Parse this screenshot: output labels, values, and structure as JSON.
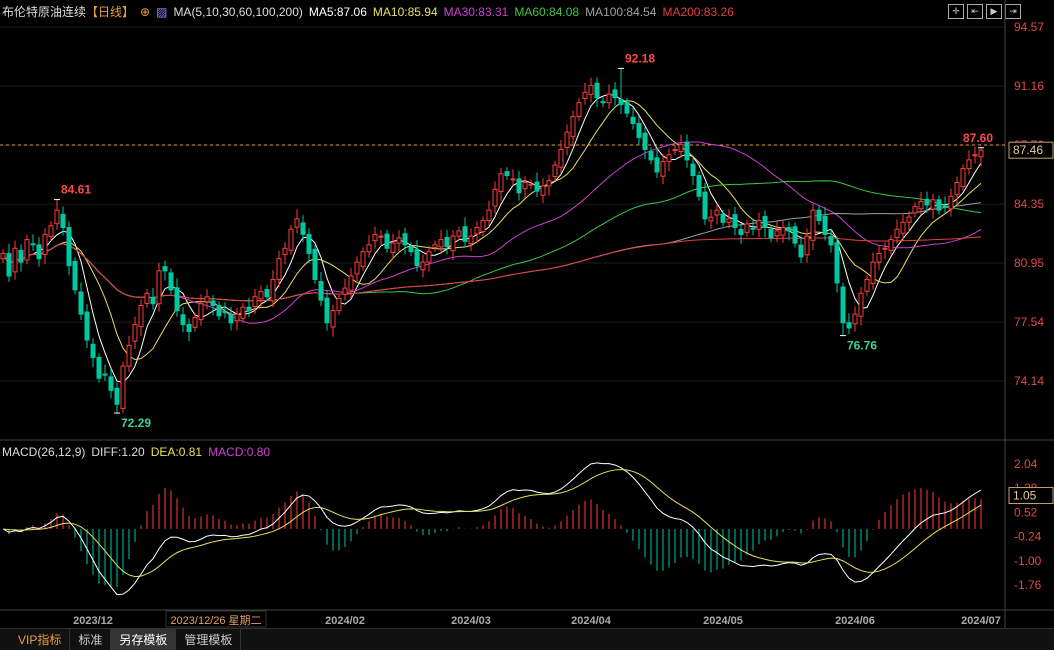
{
  "header": {
    "title": "布伦特原油连续",
    "period": "【日线】",
    "ma_label": "MA(5,10,30,60,100,200)",
    "ma5": "MA5:87.06",
    "ma10": "MA10:85.94",
    "ma30": "MA30:83.31",
    "ma60": "MA60:84.08",
    "ma100": "MA100:84.54",
    "ma200": "MA200:83.26"
  },
  "macd_header": {
    "label": "MACD(26,12,9)",
    "diff": "DIFF:1.20",
    "dea": "DEA:0.81",
    "macd": "MACD:0.80"
  },
  "toolbar_icons": [
    "crosshair-icon",
    "zoom-range-icon",
    "play-icon",
    "exit-icon"
  ],
  "bottom_tabs": [
    "VIP指标",
    "标准",
    "另存模板",
    "管理模板"
  ],
  "colors": {
    "up": "#ff3c3c",
    "down": "#00c8a0",
    "ma5": "#ffffff",
    "ma10": "#e8e060",
    "ma30": "#d040d0",
    "ma60": "#3cc83c",
    "ma100": "#a0a0a0",
    "ma200": "#e04040"
  },
  "chart_data": {
    "type": "candlestick",
    "price_axis": {
      "ticks": [
        "94.57",
        "91.16",
        "87.76",
        "84.35",
        "80.95",
        "77.54",
        "74.14"
      ],
      "range": [
        74.14,
        94.57
      ],
      "current": "87.46",
      "dashed_level": 87.76
    },
    "macd_axis": {
      "ticks": [
        "2.04",
        "1.28",
        "0.52",
        "-0.24",
        "-1.00",
        "-1.76"
      ],
      "range": [
        -1.76,
        2.04
      ],
      "current": "1.05"
    },
    "closes": [
      81.5,
      80.2,
      81.8,
      81.0,
      82.3,
      82.0,
      81.2,
      82.6,
      83.1,
      84.0,
      83.0,
      80.8,
      79.4,
      78.0,
      76.5,
      75.5,
      74.3,
      74.5,
      73.6,
      72.8,
      75.0,
      76.2,
      77.4,
      78.5,
      79.2,
      78.6,
      80.5,
      80.5,
      79.4,
      78.2,
      77.4,
      77.0,
      77.8,
      78.6,
      79.0,
      78.5,
      77.9,
      78.1,
      77.5,
      78.0,
      78.4,
      78.2,
      79.0,
      79.3,
      79.0,
      80.0,
      81.2,
      81.8,
      82.9,
      83.5,
      82.6,
      81.5,
      80.0,
      78.8,
      77.5,
      78.2,
      78.9,
      79.5,
      80.2,
      81.0,
      81.6,
      82.0,
      82.6,
      82.5,
      81.8,
      82.1,
      82.4,
      82.0,
      81.6,
      80.8,
      81.0,
      81.6,
      82.0,
      82.3,
      81.9,
      82.5,
      82.8,
      82.2,
      82.5,
      83.0,
      83.4,
      84.0,
      85.2,
      86.1,
      86.0,
      85.8,
      85.0,
      85.6,
      85.5,
      85.1,
      85.4,
      85.7,
      86.6,
      87.5,
      88.5,
      89.4,
      90.2,
      90.8,
      91.2,
      90.5,
      90.2,
      90.7,
      90.5,
      90.1,
      89.6,
      89.0,
      88.2,
      87.5,
      86.9,
      86.2,
      86.8,
      87.2,
      87.5,
      87.8,
      86.9,
      86.0,
      84.8,
      83.5,
      83.6,
      84.0,
      83.3,
      83.5,
      83.0,
      82.6,
      83.2,
      82.9,
      83.4,
      83.0,
      82.4,
      82.8,
      83.0,
      82.8,
      82.1,
      81.3,
      82.5,
      84.0,
      83.4,
      82.6,
      82.0,
      79.8,
      77.5,
      77.2,
      78.0,
      79.2,
      80.0,
      81.0,
      81.5,
      81.8,
      82.3,
      82.9,
      83.3,
      83.6,
      84.2,
      84.5,
      84.3,
      84.6,
      84.0,
      84.2,
      84.8,
      85.6,
      86.4,
      86.9,
      87.2,
      87.46
    ],
    "annotations": [
      {
        "index": 9,
        "type": "high",
        "value": 84.61,
        "label": "84.61"
      },
      {
        "index": 19,
        "type": "low",
        "value": 72.29,
        "label": "72.29"
      },
      {
        "index": 103,
        "type": "high",
        "value": 92.18,
        "label": "92.18"
      },
      {
        "index": 140,
        "type": "low",
        "value": 76.76,
        "label": "76.76"
      },
      {
        "index": 163,
        "type": "high",
        "value": 87.6,
        "label": "87.60"
      }
    ],
    "x_labels": [
      {
        "index": 15,
        "label": "2023/12"
      },
      {
        "index": 57,
        "label": "2024/02"
      },
      {
        "index": 78,
        "label": "2024/03"
      },
      {
        "index": 98,
        "label": "2024/04"
      },
      {
        "index": 120,
        "label": "2024/05"
      },
      {
        "index": 142,
        "label": "2024/06"
      },
      {
        "index": 163,
        "label": "2024/07"
      }
    ],
    "cursor_date": "2023/12/26 星期二"
  }
}
